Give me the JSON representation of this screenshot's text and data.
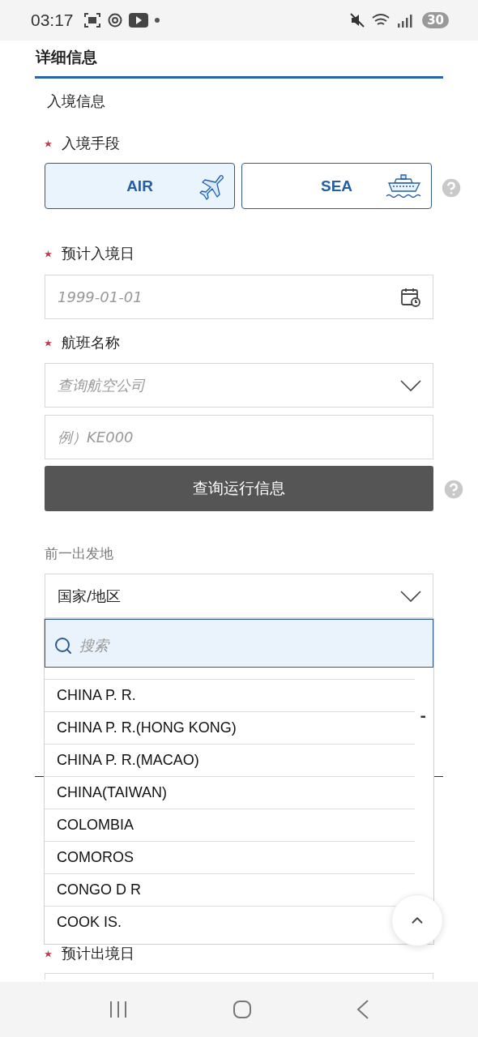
{
  "status_bar": {
    "time": "03:17",
    "battery": "30"
  },
  "section_title": "详细信息",
  "subsection_title": "入境信息",
  "entry_mode": {
    "label": "入境手段",
    "required": true,
    "options": [
      {
        "label": "AIR",
        "kind": "plane",
        "selected": true
      },
      {
        "label": "SEA",
        "kind": "ship",
        "selected": false
      }
    ]
  },
  "entry_date": {
    "label": "预计入境日",
    "required": true,
    "placeholder": "1999-01-01"
  },
  "flight": {
    "label": "航班名称",
    "required": true,
    "airline_placeholder": "查询航空公司",
    "number_placeholder": "例）KE000",
    "search_button": "查询运行信息"
  },
  "departure": {
    "label": "前一出发地",
    "select_value": "国家/地区",
    "dropdown": {
      "search_placeholder": "搜索",
      "options": [
        "CHINA P. R.",
        "CHINA P. R.(HONG KONG)",
        "CHINA P. R.(MACAO)",
        "CHINA(TAIWAN)",
        "COLOMBIA",
        "COMOROS",
        "CONGO D R",
        "COOK IS."
      ]
    }
  },
  "covered_separator": "-",
  "exit_date": {
    "label": "预计出境日",
    "required": true
  }
}
